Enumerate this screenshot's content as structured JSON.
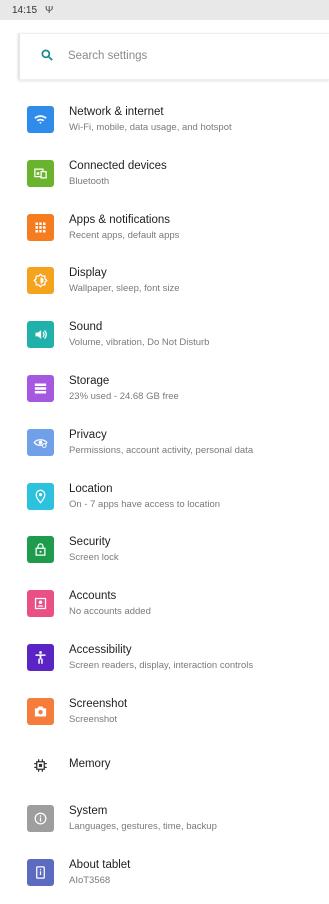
{
  "status": {
    "time": "14:15",
    "usb": "Ψ"
  },
  "search": {
    "placeholder": "Search settings"
  },
  "items": [
    {
      "title": "Network & internet",
      "subtitle": "Wi-Fi, mobile, data usage, and hotspot",
      "color": "#2f8cea",
      "icon": "wifi-icon"
    },
    {
      "title": "Connected devices",
      "subtitle": "Bluetooth",
      "color": "#6ab42d",
      "icon": "devices-icon"
    },
    {
      "title": "Apps & notifications",
      "subtitle": "Recent apps, default apps",
      "color": "#f57c1f",
      "icon": "apps-icon"
    },
    {
      "title": "Display",
      "subtitle": "Wallpaper, sleep, font size",
      "color": "#f5a21f",
      "icon": "brightness-icon"
    },
    {
      "title": "Sound",
      "subtitle": "Volume, vibration, Do Not Disturb",
      "color": "#20b2aa",
      "icon": "volume-icon"
    },
    {
      "title": "Storage",
      "subtitle": "23% used - 24.68 GB free",
      "color": "#a658e0",
      "icon": "storage-icon"
    },
    {
      "title": "Privacy",
      "subtitle": "Permissions, account activity, personal data",
      "color": "#6fa0e8",
      "icon": "privacy-eye-icon"
    },
    {
      "title": "Location",
      "subtitle": "On - 7 apps have access to location",
      "color": "#2cc1dc",
      "icon": "location-pin-icon"
    },
    {
      "title": "Security",
      "subtitle": "Screen lock",
      "color": "#1e9b4b",
      "icon": "lock-icon"
    },
    {
      "title": "Accounts",
      "subtitle": "No accounts added",
      "color": "#ea4f86",
      "icon": "account-icon"
    },
    {
      "title": "Accessibility",
      "subtitle": "Screen readers, display, interaction controls",
      "color": "#5b25c6",
      "icon": "accessibility-icon"
    },
    {
      "title": "Screenshot",
      "subtitle": "Screenshot",
      "color": "#f57c3b",
      "icon": "camera-icon"
    },
    {
      "title": "Memory",
      "subtitle": "",
      "color": "#ffffff",
      "icon": "memory-chip-icon"
    },
    {
      "title": "System",
      "subtitle": "Languages, gestures, time, backup",
      "color": "#9e9e9e",
      "icon": "info-icon"
    },
    {
      "title": "About tablet",
      "subtitle": "AIoT3568",
      "color": "#5c6bc0",
      "icon": "tablet-icon"
    }
  ]
}
